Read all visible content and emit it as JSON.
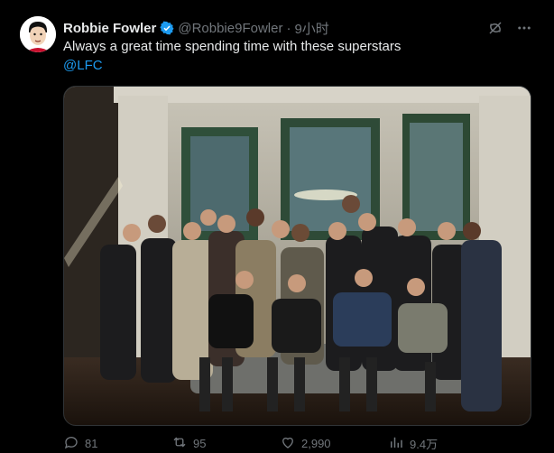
{
  "author": {
    "name": "Robbie Fowler",
    "handle": "@Robbie9Fowler",
    "sep": "·",
    "time": "9小时"
  },
  "tweet": {
    "text": "Always a great time spending time with these superstars",
    "mention": "@LFC"
  },
  "metrics": {
    "replies": "81",
    "retweets": "95",
    "likes": "2,990",
    "views": "9.4万"
  },
  "colors": {
    "accent": "#1d9bf0",
    "muted": "#71767b",
    "text": "#e7e9ea",
    "bg": "#000000"
  },
  "icons": [
    "grok-icon",
    "more-icon",
    "reply-icon",
    "retweet-icon",
    "like-icon",
    "views-icon",
    "verified-icon"
  ]
}
